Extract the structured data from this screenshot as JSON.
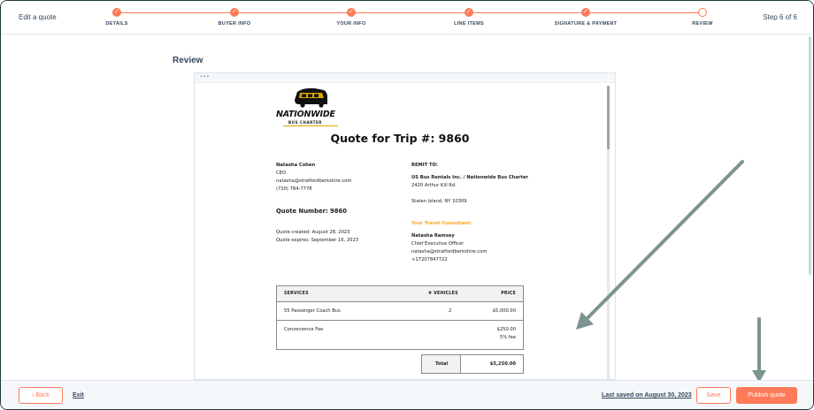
{
  "header": {
    "title": "Edit a quote",
    "step_count": "Step 6 of 6",
    "steps": [
      {
        "label": "DETAILS",
        "done": true
      },
      {
        "label": "BUYER INFO",
        "done": true
      },
      {
        "label": "YOUR INFO",
        "done": true
      },
      {
        "label": "LINE ITEMS",
        "done": true
      },
      {
        "label": "SIGNATURE & PAYMENT",
        "done": true
      },
      {
        "label": "REVIEW",
        "done": false
      }
    ],
    "check_glyph": "✓",
    "accent_color": "#ff7a59"
  },
  "main": {
    "section_title": "Review",
    "preview_dots": "•••"
  },
  "quote": {
    "logo_word": "NATIONWIDE",
    "logo_sub": "BUS CHARTER",
    "title": "Quote for Trip #: 9860",
    "buyer": {
      "name": "Natasha Cohen",
      "role": "CEO",
      "email": "natasha@stratfordberkshire.com",
      "phone": "(720) 784-7778"
    },
    "quote_number": "Quote Number: 9860",
    "created": "Quote created: August 28, 2023",
    "expires": "Quote expires: September 16, 2023",
    "remit": {
      "heading": "REMIT TO:",
      "company": "US Bus Rentals Inc. / Nationwide Bus Charter",
      "street": "2420 Arthur Kill Rd.",
      "city": "Staten Island, NY 10309"
    },
    "consultant": {
      "heading": "Your Travel Consultant:",
      "name": "Natasha Ramsey",
      "role": "Chief Executive Officer",
      "email": "natasha@stratfordberkshire.com",
      "phone": "+17207847722"
    },
    "table": {
      "headers": {
        "services": "SERVICES",
        "vehicles": "# VEHICLES",
        "price": "PRICE"
      },
      "rows": [
        {
          "service": "55 Passenger Coach Bus",
          "vehicles": "2",
          "price": "$5,000.00"
        },
        {
          "service": "Convenience Fee",
          "vehicles": "",
          "price": "$250.00",
          "note": "5% fee"
        }
      ]
    },
    "total_label": "Total",
    "total_value": "$5,250.00"
  },
  "footer": {
    "back_label": "Back",
    "back_icon": "‹",
    "exit_label": "Exit",
    "last_saved": "Last saved on August 30, 2023",
    "save_label": "Save",
    "publish_label": "Publish quote"
  }
}
